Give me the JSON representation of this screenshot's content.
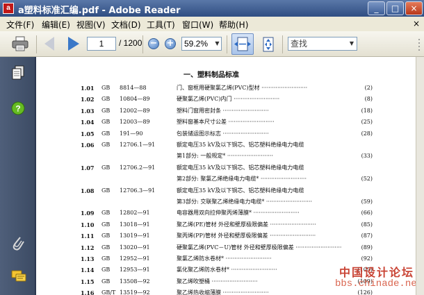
{
  "window": {
    "app_icon_text": "a",
    "title": "a塑料标准汇编.pdf - Adobe Reader",
    "minimize": "_",
    "maximize": "□",
    "close": "×"
  },
  "menu": {
    "items": [
      "文件(F)",
      "编辑(E)",
      "视图(V)",
      "文档(D)",
      "工具(T)",
      "窗口(W)",
      "帮助(H)"
    ],
    "close_glyph": "×"
  },
  "toolbar": {
    "page_current": "1",
    "page_total": "/ 1200",
    "zoom_out": "−",
    "zoom_in": "+",
    "zoom_value": "59.2%",
    "dropdown_glyph": "▼",
    "search_placeholder": "查找"
  },
  "colors": {
    "titlebar": "#2f4d82",
    "menubar": "#ece9d8",
    "sidebar": "#45546e",
    "watermark": "#c43020",
    "nav_arrow": "#3a78c8"
  },
  "sidebar_icons": [
    "pages-icon",
    "help-icon",
    "attachment-icon",
    "comments-icon"
  ],
  "document": {
    "heading": "一、塑料制品标准",
    "rows": [
      {
        "no": "1.01",
        "std": "GB",
        "code": "8814—88",
        "title": "门、窗框用硬聚氯乙烯(PVC)型材 ··························",
        "page": "(2)"
      },
      {
        "no": "1.02",
        "std": "GB",
        "code": "10804—89",
        "title": "硬聚氯乙烯(PVC)内门 ··························",
        "page": "(8)"
      },
      {
        "no": "1.03",
        "std": "GB",
        "code": "12002—89",
        "title": "塑料门窗用密封条 ··························",
        "page": "(18)"
      },
      {
        "no": "1.04",
        "std": "GB",
        "code": "12003—89",
        "title": "塑料窗基本尺寸公差 ··························",
        "page": "(25)"
      },
      {
        "no": "1.05",
        "std": "GB",
        "code": "191—90",
        "title": "包装储运图示标志 ··························",
        "page": "(28)"
      },
      {
        "no": "1.06",
        "std": "GB",
        "code": "12706.1—91",
        "title": "额定电压35 kV及以下铜芯、铝芯塑料绝缘电力电缆",
        "page": ""
      },
      {
        "no": "",
        "std": "",
        "code": "",
        "title": "第1部分: 一般规定* ··························",
        "page": "(33)"
      },
      {
        "no": "1.07",
        "std": "GB",
        "code": "12706.2—91",
        "title": "额定电压35 kV及以下铜芯、铝芯塑料绝缘电力电缆",
        "page": ""
      },
      {
        "no": "",
        "std": "",
        "code": "",
        "title": "第2部分: 聚氯乙烯绝缘电力电缆* ··························",
        "page": "(52)"
      },
      {
        "no": "1.08",
        "std": "GB",
        "code": "12706.3—91",
        "title": "额定电压35 kV及以下铜芯、铝芯塑料绝缘电力电缆",
        "page": ""
      },
      {
        "no": "",
        "std": "",
        "code": "",
        "title": "第3部分: 交联聚乙烯绝缘电力电缆* ··························",
        "page": "(59)"
      },
      {
        "no": "1.09",
        "std": "GB",
        "code": "12802—91",
        "title": "电容器用双向拉伸聚丙烯薄膜* ··························",
        "page": "(66)"
      },
      {
        "no": "1.10",
        "std": "GB",
        "code": "13018—91",
        "title": "聚乙烯(PE)管材 外径和壁厚极限偏差 ··························",
        "page": "(85)"
      },
      {
        "no": "1.11",
        "std": "GB",
        "code": "13019—91",
        "title": "聚丙烯(PP)管材 外径和壁厚极限偏差 ··························",
        "page": "(87)"
      },
      {
        "no": "1.12",
        "std": "GB",
        "code": "13020—91",
        "title": "硬聚氯乙烯(PVC－U)管材 外径和壁厚极限偏差 ··························",
        "page": "(89)"
      },
      {
        "no": "1.13",
        "std": "GB",
        "code": "12952—91",
        "title": "聚氯乙烯防水卷材* ··························",
        "page": "(92)"
      },
      {
        "no": "1.14",
        "std": "GB",
        "code": "12953—91",
        "title": "氯化聚乙烯防水卷材* ··························",
        "page": "(105)"
      },
      {
        "no": "1.15",
        "std": "GB",
        "code": "13508—92",
        "title": "聚乙烯吹塑桶 ··························",
        "page": "(109)"
      },
      {
        "no": "1.16",
        "std": "GB/T",
        "code": "13519—92",
        "title": "聚乙烯热收缩薄膜 ··························",
        "page": "(126)"
      }
    ]
  },
  "watermark": {
    "line1": "中国设计论坛",
    "line2": "bbs.chinade.net"
  }
}
